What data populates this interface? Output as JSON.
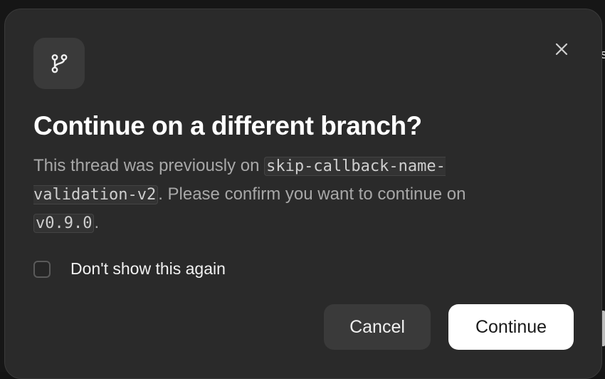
{
  "dialog": {
    "title": "Continue on a different branch?",
    "body_prefix": "This thread was previously on ",
    "previous_branch": "skip-callback-name-validation-v2",
    "body_middle": ". Please confirm you want to continue on ",
    "target_branch": "v0.9.0",
    "body_suffix": ".",
    "checkbox_label": "Don't show this again",
    "checkbox_checked": false,
    "cancel_label": "Cancel",
    "continue_label": "Continue",
    "header_icon": "git-branch-icon",
    "close_icon": "close-icon"
  },
  "colors": {
    "dialog_background": "#2a2a2a",
    "title": "#ffffff",
    "body_text": "#a8a8a8",
    "primary_button": "#ffffff",
    "secondary_button": "#3a3a3a"
  }
}
